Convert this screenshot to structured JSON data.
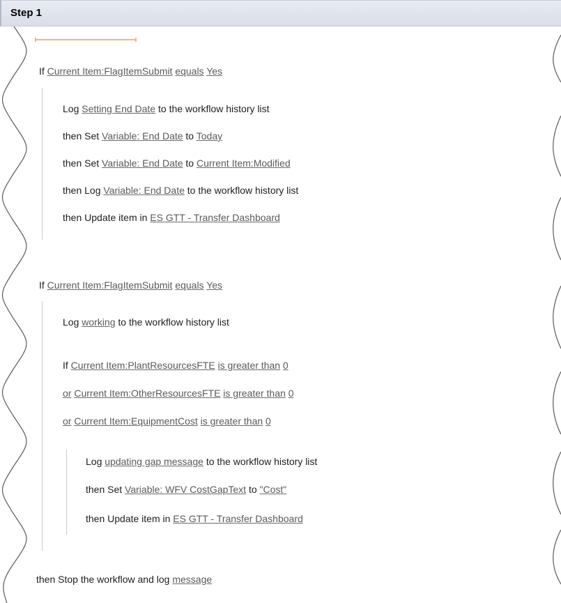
{
  "step": {
    "title": "Step 1"
  },
  "block1": {
    "condition": {
      "kw": "If",
      "field": "Current Item:FlagItemSubmit",
      "op": "equals",
      "value": "Yes"
    },
    "actions": [
      {
        "pre": "Log",
        "link1": "Setting End Date",
        "mid": "to the workflow history list"
      },
      {
        "pre": "then Set",
        "link1": "Variable: End Date",
        "mid": "to",
        "link2": "Today"
      },
      {
        "pre": "then Set",
        "link1": "Variable: End Date",
        "mid": "to",
        "link2": "Current Item:Modified"
      },
      {
        "pre": "then Log",
        "link1": "Variable: End Date",
        "mid": "to the workflow history list"
      },
      {
        "pre": "then Update item in",
        "link1": "ES GTT - Transfer Dashboard"
      }
    ]
  },
  "block2": {
    "condition": {
      "kw": "If",
      "field": "Current Item:FlagItemSubmit",
      "op": "equals",
      "value": "Yes"
    },
    "log": {
      "pre": "Log",
      "link1": "working",
      "mid": "to the workflow history list"
    },
    "inner": {
      "conditions": [
        {
          "kw": "If",
          "field": "Current Item:PlantResourcesFTE",
          "op": "is greater than",
          "value": "0"
        },
        {
          "kw": "or",
          "field": "Current Item:OtherResourcesFTE",
          "op": "is greater than",
          "value": "0"
        },
        {
          "kw": "or",
          "field": "Current Item:EquipmentCost",
          "op": "is greater than",
          "value": "0"
        }
      ],
      "actions": [
        {
          "pre": "Log",
          "link1": "updating gap message",
          "mid": "to the workflow history list"
        },
        {
          "pre": "then Set",
          "link1": "Variable: WFV CostGapText",
          "mid": "to",
          "link2": "\"Cost\""
        },
        {
          "pre": "then Update item in",
          "link1": "ES GTT - Transfer Dashboard"
        }
      ]
    }
  },
  "final": {
    "pre": "then Stop the workflow and log",
    "link1": "message"
  },
  "colors": {
    "header_bg": "#dfe3ea",
    "link": "#5a5a5a",
    "cursor": "#f3b57e",
    "bar": "#c9cbd3"
  }
}
